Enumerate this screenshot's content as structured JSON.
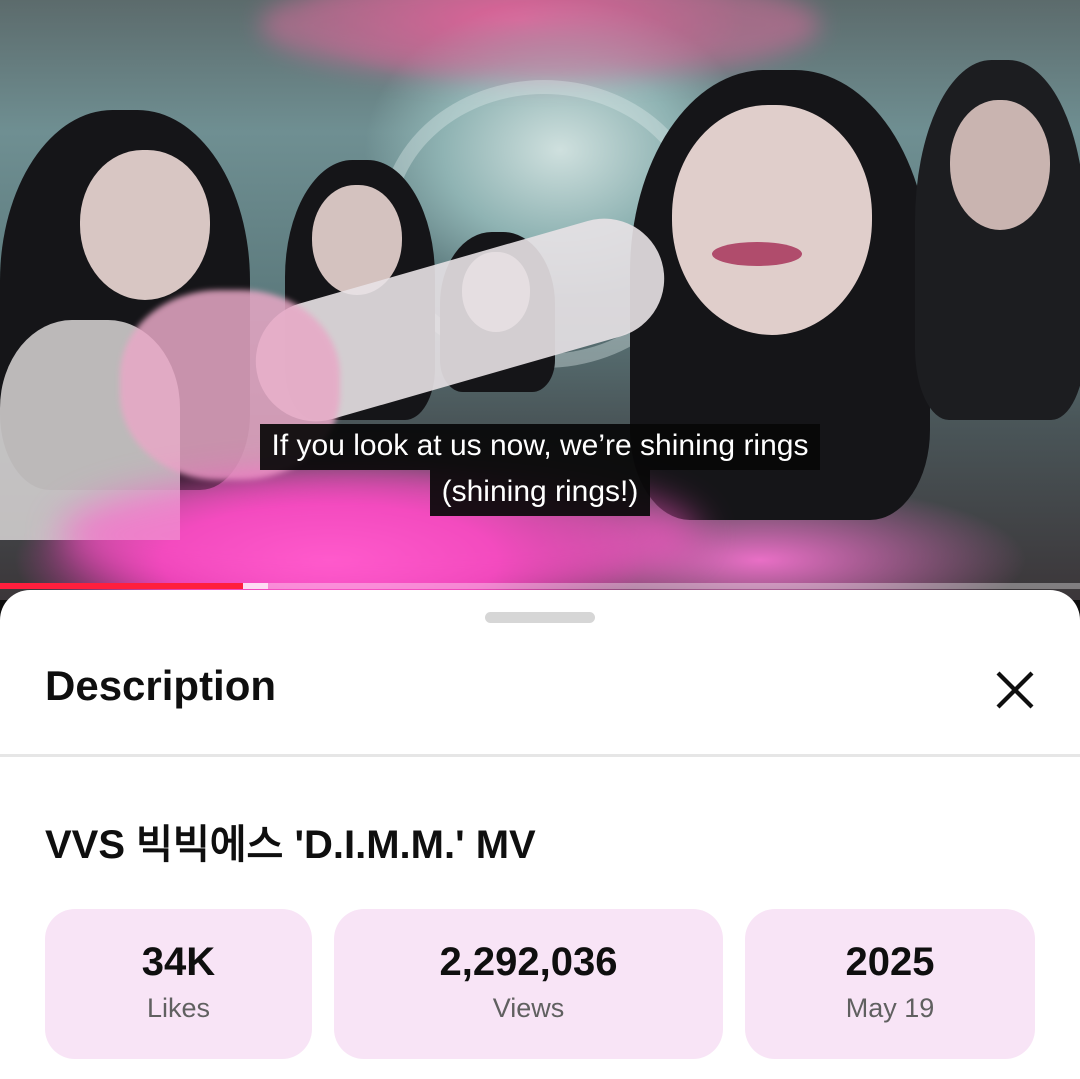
{
  "player": {
    "subtitle_line1": "If you look at us now, we’re shining rings",
    "subtitle_line2": "(shining rings!)",
    "progress": 0.225,
    "buffered": 0.248,
    "progress_color": "#ff1f3d"
  },
  "sheet": {
    "title": "Description",
    "close_icon": "close-icon",
    "video_title": "VVS 빅빅에스 'D.I.M.M.' MV",
    "stats": [
      {
        "value": "34K",
        "label": "Likes"
      },
      {
        "value": "2,292,036",
        "label": "Views"
      },
      {
        "value": "2025",
        "label": "May 19"
      }
    ],
    "stat_bg": "#f8e4f6"
  }
}
